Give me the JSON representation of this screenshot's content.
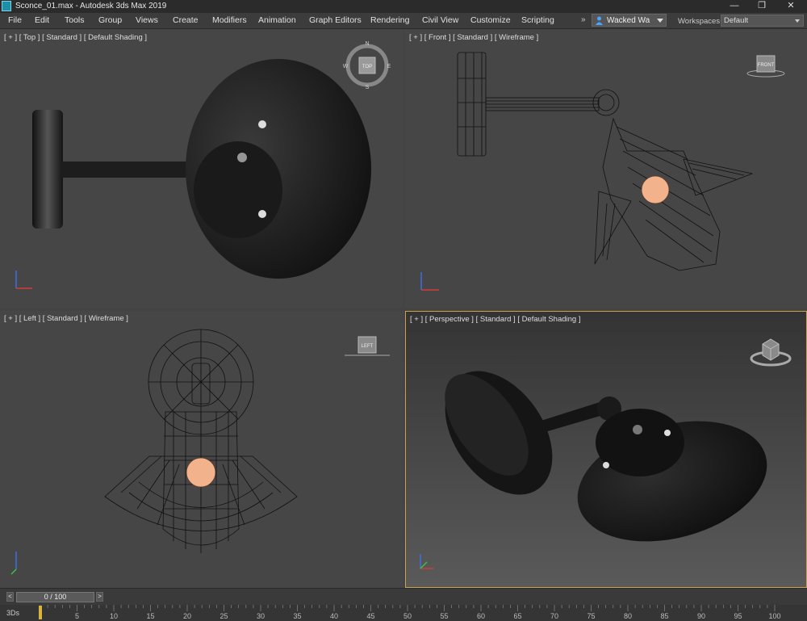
{
  "window": {
    "title": "Sconce_01.max - Autodesk 3ds Max 2019",
    "min_glyph": "—",
    "max_glyph": "❐",
    "close_glyph": "✕"
  },
  "menu": {
    "items": [
      "File",
      "Edit",
      "Tools",
      "Group",
      "Views",
      "Create",
      "Modifiers",
      "Animation",
      "Graph Editors",
      "Rendering",
      "Civil View",
      "Customize",
      "Scripting"
    ],
    "overflow": "»",
    "user": "Wacked Wa",
    "workspaces_label": "Workspaces:",
    "workspace_value": "Default"
  },
  "viewports": {
    "top": {
      "label": "[ + ] [ Top ] [ Standard ] [ Default Shading ]",
      "cube": "TOP"
    },
    "front": {
      "label": "[ + ] [ Front ] [ Standard ] [ Wireframe ]",
      "cube": "FRONT"
    },
    "left": {
      "label": "[ + ] [ Left ] [ Standard ] [ Wireframe ]",
      "cube": "LEFT"
    },
    "perspective": {
      "label": "[ + ] [ Perspective ] [ Standard ] [ Default Shading ]"
    }
  },
  "compass": {
    "n": "N",
    "s": "S",
    "e": "E",
    "w": "W"
  },
  "timeline": {
    "frame_display": "0 / 100",
    "left_arrow": "<",
    "right_arrow": ">",
    "track_label": "3Ds",
    "ticks": [
      "5",
      "10",
      "15",
      "20",
      "25",
      "30",
      "35",
      "40",
      "45",
      "50",
      "55",
      "60",
      "65",
      "70",
      "75",
      "80",
      "85",
      "90",
      "95",
      "100"
    ]
  },
  "colors": {
    "viewport_bg": "#464646",
    "active_border": "#c9a24a",
    "axis_x": "#d23c3c",
    "axis_y": "#3fbf3f",
    "axis_z": "#3f6fe0",
    "bulb": "#f2b38c"
  }
}
